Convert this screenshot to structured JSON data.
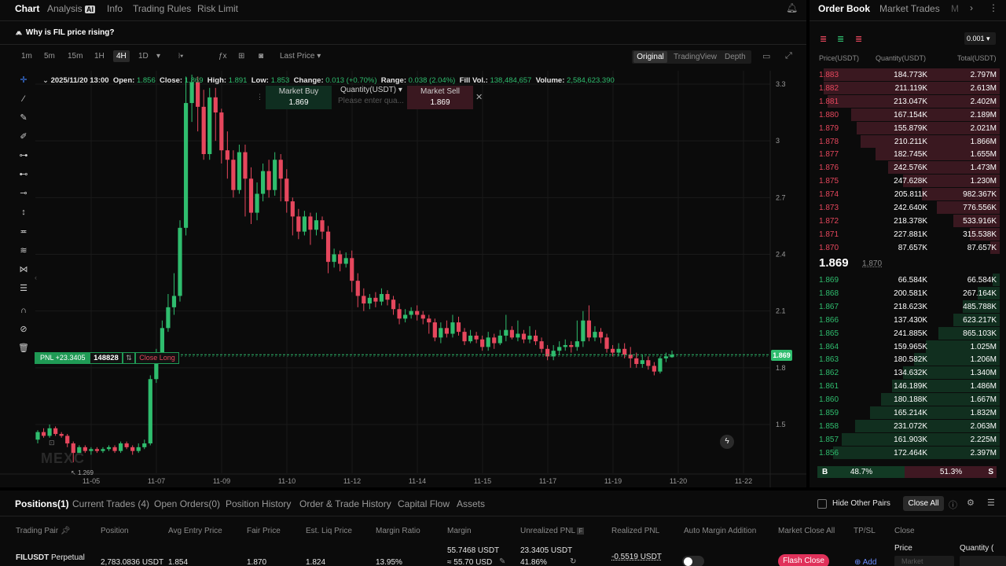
{
  "header": {
    "tabs": [
      {
        "label": "Chart",
        "active": true
      },
      {
        "label": "Analysis",
        "badge": "AI"
      },
      {
        "label": "Info"
      },
      {
        "label": "Trading Rules"
      },
      {
        "label": "Risk Limit"
      }
    ],
    "ai_prompt": "Why is FIL price rising?"
  },
  "toolbar": {
    "timeframes": [
      "1m",
      "5m",
      "15m",
      "1H",
      "4H",
      "1D"
    ],
    "active_timeframe": "4H",
    "price_type": "Last Price",
    "views": [
      "Original",
      "TradingView",
      "Depth"
    ],
    "active_view": "Original"
  },
  "ohlc": {
    "date": "2025/11/20 13:00",
    "open_label": "Open:",
    "open": "1.856",
    "close_label": "Close:",
    "close": "1.869",
    "high_label": "High:",
    "high": "1.891",
    "low_label": "Low:",
    "low": "1.853",
    "change_label": "Change:",
    "change": "0.013 (+0.70%)",
    "range_label": "Range:",
    "range": "0.038 (2.04%)",
    "fill_vol_label": "Fill Vol.:",
    "fill_vol": "138,484,657",
    "volume_label": "Volume:",
    "volume": "2,584,623.390"
  },
  "quick_trade": {
    "buy_label": "Market Buy",
    "buy_price": "1.869",
    "qty_label": "Quantity(USDT)",
    "qty_placeholder": "Please enter qua...",
    "sell_label": "Market Sell",
    "sell_price": "1.869"
  },
  "position_line": {
    "pnl": "PNL +23.3405",
    "qty": "148828",
    "close_label": "Close Long",
    "current_price": "1.869"
  },
  "watermark": "MEXC",
  "chart_data": {
    "type": "candlestick",
    "y_ticks": [
      "3.3",
      "3",
      "2.7",
      "2.4",
      "2.1",
      "1.8",
      "1.5"
    ],
    "ylim": [
      1.27,
      3.35
    ],
    "x_ticks": [
      "11-05",
      "11-07",
      "11-09",
      "11-10",
      "11-12",
      "11-14",
      "11-15",
      "11-17",
      "11-19",
      "11-20",
      "11-22"
    ],
    "low_label": "1.269",
    "candles": [
      [
        1.42,
        1.46,
        1.4,
        1.47
      ],
      [
        1.46,
        1.44,
        1.43,
        1.48
      ],
      [
        1.44,
        1.48,
        1.43,
        1.5
      ],
      [
        1.48,
        1.45,
        1.44,
        1.49
      ],
      [
        1.45,
        1.44,
        1.43,
        1.46
      ],
      [
        1.44,
        1.4,
        1.38,
        1.45
      ],
      [
        1.4,
        1.35,
        1.3,
        1.41
      ],
      [
        1.35,
        1.38,
        1.34,
        1.39
      ],
      [
        1.38,
        1.36,
        1.35,
        1.39
      ],
      [
        1.36,
        1.37,
        1.34,
        1.38
      ],
      [
        1.37,
        1.36,
        1.35,
        1.38
      ],
      [
        1.36,
        1.37,
        1.35,
        1.38
      ],
      [
        1.37,
        1.38,
        1.36,
        1.39
      ],
      [
        1.38,
        1.36,
        1.35,
        1.39
      ],
      [
        1.36,
        1.4,
        1.35,
        1.41
      ],
      [
        1.4,
        1.38,
        1.37,
        1.41
      ],
      [
        1.38,
        1.36,
        1.34,
        1.39
      ],
      [
        1.36,
        1.38,
        1.35,
        1.4
      ],
      [
        1.38,
        1.4,
        1.37,
        1.42
      ],
      [
        1.4,
        1.74,
        1.39,
        1.76
      ],
      [
        1.74,
        1.86,
        1.72,
        1.9
      ],
      [
        1.86,
        2.01,
        1.84,
        2.05
      ],
      [
        2.01,
        2.12,
        1.99,
        2.19
      ],
      [
        2.12,
        2.18,
        2.08,
        2.3
      ],
      [
        2.18,
        2.54,
        2.15,
        2.58
      ],
      [
        2.54,
        3.2,
        2.5,
        3.34
      ],
      [
        3.2,
        3.31,
        3.1,
        3.35
      ],
      [
        3.31,
        3.18,
        3.05,
        3.34
      ],
      [
        3.18,
        2.93,
        2.9,
        3.27
      ],
      [
        2.93,
        3.23,
        2.9,
        3.28
      ],
      [
        3.23,
        3.15,
        3.0,
        3.28
      ],
      [
        3.15,
        2.95,
        2.88,
        3.17
      ],
      [
        2.95,
        2.9,
        2.8,
        3.05
      ],
      [
        2.9,
        2.74,
        2.7,
        2.95
      ],
      [
        2.74,
        2.94,
        2.72,
        2.98
      ],
      [
        2.94,
        2.8,
        2.6,
        2.98
      ],
      [
        2.8,
        2.62,
        2.56,
        2.86
      ],
      [
        2.62,
        2.72,
        2.58,
        2.78
      ],
      [
        2.72,
        2.84,
        2.68,
        2.88
      ],
      [
        2.84,
        2.74,
        2.7,
        2.9
      ],
      [
        2.74,
        2.9,
        2.71,
        2.94
      ],
      [
        2.9,
        2.8,
        2.68,
        2.93
      ],
      [
        2.8,
        2.68,
        2.62,
        2.85
      ],
      [
        2.68,
        2.6,
        2.5,
        2.7
      ],
      [
        2.6,
        2.52,
        2.48,
        2.64
      ],
      [
        2.52,
        2.6,
        2.5,
        2.63
      ],
      [
        2.6,
        2.53,
        2.45,
        2.62
      ],
      [
        2.53,
        2.58,
        2.5,
        2.62
      ],
      [
        2.58,
        2.52,
        2.48,
        2.6
      ],
      [
        2.52,
        2.36,
        2.3,
        2.55
      ],
      [
        2.36,
        2.4,
        2.33,
        2.43
      ],
      [
        2.4,
        2.35,
        2.31,
        2.42
      ],
      [
        2.35,
        2.38,
        2.33,
        2.41
      ],
      [
        2.38,
        2.26,
        2.2,
        2.42
      ],
      [
        2.26,
        2.18,
        2.12,
        2.3
      ],
      [
        2.18,
        2.14,
        2.1,
        2.22
      ],
      [
        2.14,
        2.17,
        2.11,
        2.19
      ],
      [
        2.17,
        2.15,
        2.12,
        2.2
      ],
      [
        2.15,
        2.19,
        2.13,
        2.22
      ],
      [
        2.19,
        2.16,
        2.13,
        2.21
      ],
      [
        2.16,
        2.11,
        2.08,
        2.18
      ],
      [
        2.11,
        2.06,
        2.03,
        2.14
      ],
      [
        2.06,
        2.08,
        2.04,
        2.11
      ],
      [
        2.08,
        2.1,
        2.06,
        2.12
      ],
      [
        2.1,
        2.08,
        2.05,
        2.13
      ],
      [
        2.08,
        2.06,
        2.03,
        2.1
      ],
      [
        2.06,
        2.04,
        1.98,
        2.08
      ],
      [
        2.04,
        1.96,
        1.94,
        2.06
      ],
      [
        1.96,
        2.01,
        1.93,
        2.04
      ],
      [
        2.01,
        1.98,
        1.96,
        2.05
      ],
      [
        1.98,
        2.04,
        1.96,
        2.08
      ],
      [
        2.04,
        1.99,
        1.97,
        2.07
      ],
      [
        1.99,
        1.94,
        1.92,
        2.01
      ],
      [
        1.94,
        1.97,
        1.93,
        2.0
      ],
      [
        1.97,
        1.95,
        1.93,
        1.99
      ],
      [
        1.95,
        1.91,
        1.89,
        1.97
      ],
      [
        1.91,
        1.96,
        1.89,
        1.99
      ],
      [
        1.96,
        1.93,
        1.9,
        1.98
      ],
      [
        1.93,
        1.97,
        1.92,
        2.0
      ],
      [
        1.97,
        2.0,
        1.94,
        2.08
      ],
      [
        2.0,
        1.96,
        1.95,
        2.02
      ],
      [
        1.96,
        1.98,
        1.94,
        2.05
      ],
      [
        1.98,
        1.95,
        1.93,
        2.0
      ],
      [
        1.95,
        1.97,
        1.93,
        2.02
      ],
      [
        1.97,
        1.94,
        1.92,
        2.0
      ],
      [
        1.94,
        1.9,
        1.88,
        1.96
      ],
      [
        1.9,
        1.86,
        1.84,
        1.92
      ],
      [
        1.86,
        1.89,
        1.84,
        1.92
      ],
      [
        1.89,
        1.91,
        1.87,
        1.94
      ],
      [
        1.91,
        1.92,
        1.89,
        1.95
      ],
      [
        1.92,
        1.91,
        1.88,
        1.94
      ],
      [
        1.91,
        1.94,
        1.89,
        2.05
      ],
      [
        1.94,
        2.05,
        1.91,
        2.1
      ],
      [
        2.05,
        1.96,
        1.94,
        2.13
      ],
      [
        1.96,
        1.99,
        1.94,
        2.02
      ],
      [
        1.99,
        1.96,
        1.93,
        2.01
      ],
      [
        1.96,
        1.9,
        1.88,
        1.98
      ],
      [
        1.9,
        1.88,
        1.86,
        1.92
      ],
      [
        1.88,
        1.9,
        1.86,
        1.93
      ],
      [
        1.9,
        1.87,
        1.85,
        1.93
      ],
      [
        1.87,
        1.85,
        1.8,
        1.91
      ],
      [
        1.85,
        1.82,
        1.8,
        1.88
      ],
      [
        1.82,
        1.84,
        1.8,
        1.87
      ],
      [
        1.84,
        1.81,
        1.79,
        1.86
      ],
      [
        1.81,
        1.78,
        1.76,
        1.83
      ],
      [
        1.78,
        1.85,
        1.77,
        1.86
      ],
      [
        1.85,
        1.86,
        1.83,
        1.88
      ],
      [
        1.856,
        1.869,
        1.853,
        1.891
      ]
    ]
  },
  "orderbook": {
    "tabs": [
      "Order Book",
      "Market Trades",
      "M"
    ],
    "precision": "0.001",
    "headers": [
      "Price(USDT)",
      "Quantity(USDT)",
      "Total(USDT)"
    ],
    "asks": [
      [
        "1.883",
        "184.773K",
        "2.797M",
        0.95
      ],
      [
        "1.882",
        "211.119K",
        "2.613M",
        0.95
      ],
      [
        "1.881",
        "213.047K",
        "2.402M",
        0.93
      ],
      [
        "1.880",
        "167.154K",
        "2.189M",
        0.8
      ],
      [
        "1.879",
        "155.879K",
        "2.021M",
        0.77
      ],
      [
        "1.878",
        "210.211K",
        "1.866M",
        0.75
      ],
      [
        "1.877",
        "182.745K",
        "1.655M",
        0.67
      ],
      [
        "1.876",
        "242.576K",
        "1.473M",
        0.6
      ],
      [
        "1.875",
        "247.628K",
        "1.230M",
        0.52
      ],
      [
        "1.874",
        "205.811K",
        "982.367K",
        0.42
      ],
      [
        "1.873",
        "242.640K",
        "776.556K",
        0.34
      ],
      [
        "1.872",
        "218.378K",
        "533.916K",
        0.25
      ],
      [
        "1.871",
        "227.881K",
        "315.538K",
        0.16
      ],
      [
        "1.870",
        "87.657K",
        "87.657K",
        0.05
      ]
    ],
    "last_price": "1.869",
    "mark_price": "1.870",
    "bids": [
      [
        "1.869",
        "66.584K",
        "66.584K",
        0.04
      ],
      [
        "1.868",
        "200.581K",
        "267.164K",
        0.12
      ],
      [
        "1.867",
        "218.623K",
        "485.788K",
        0.2
      ],
      [
        "1.866",
        "137.430K",
        "623.217K",
        0.25
      ],
      [
        "1.865",
        "241.885K",
        "865.103K",
        0.33
      ],
      [
        "1.864",
        "159.965K",
        "1.025M",
        0.4
      ],
      [
        "1.863",
        "180.582K",
        "1.206M",
        0.46
      ],
      [
        "1.862",
        "134.632K",
        "1.340M",
        0.52
      ],
      [
        "1.861",
        "146.189K",
        "1.486M",
        0.58
      ],
      [
        "1.860",
        "180.188K",
        "1.667M",
        0.64
      ],
      [
        "1.859",
        "165.214K",
        "1.832M",
        0.7
      ],
      [
        "1.858",
        "231.072K",
        "2.063M",
        0.78
      ],
      [
        "1.857",
        "161.903K",
        "2.225M",
        0.85
      ],
      [
        "1.856",
        "172.464K",
        "2.397M",
        0.9
      ]
    ],
    "buy_ratio_label": "B",
    "buy_ratio": "48.7%",
    "sell_ratio_label": "S",
    "sell_ratio": "51.3%"
  },
  "positions": {
    "tabs": [
      "Positions(1)",
      "Current Trades (4)",
      "Open Orders(0)",
      "Position History",
      "Order & Trade History",
      "Capital Flow",
      "Assets"
    ],
    "hide_pairs": "Hide Other Pairs",
    "close_all": "Close All",
    "columns": [
      "Trading Pair",
      "Position",
      "Avg Entry Price",
      "Fair Price",
      "Est. Liq Price",
      "Margin Ratio",
      "Margin",
      "Unrealized PNL",
      "Realized PNL",
      "Auto Margin Addition",
      "Market Close All",
      "TP/SL",
      "Close"
    ],
    "row": {
      "pair": "FILUSDT",
      "type": "Perpetual",
      "position": "2,783.0836 USDT",
      "avg_entry": "1.854",
      "fair_price": "1.870",
      "liq_price": "1.824",
      "margin_ratio": "13.95%",
      "margin": "55.7468 USDT",
      "margin_approx": "≈ 55.70 USD",
      "upnl": "23.3405 USDT",
      "upnl_pct": "41.86%",
      "rpnl": "-0.5519 USDT",
      "flash_close": "Flash Close",
      "add": "Add",
      "price_label": "Price",
      "qty_label": "Quantity (",
      "market_placeholder": "Market"
    }
  },
  "colors": {
    "up": "#2fbd6e",
    "down": "#e6475d",
    "bg": "#0b0b0b"
  }
}
